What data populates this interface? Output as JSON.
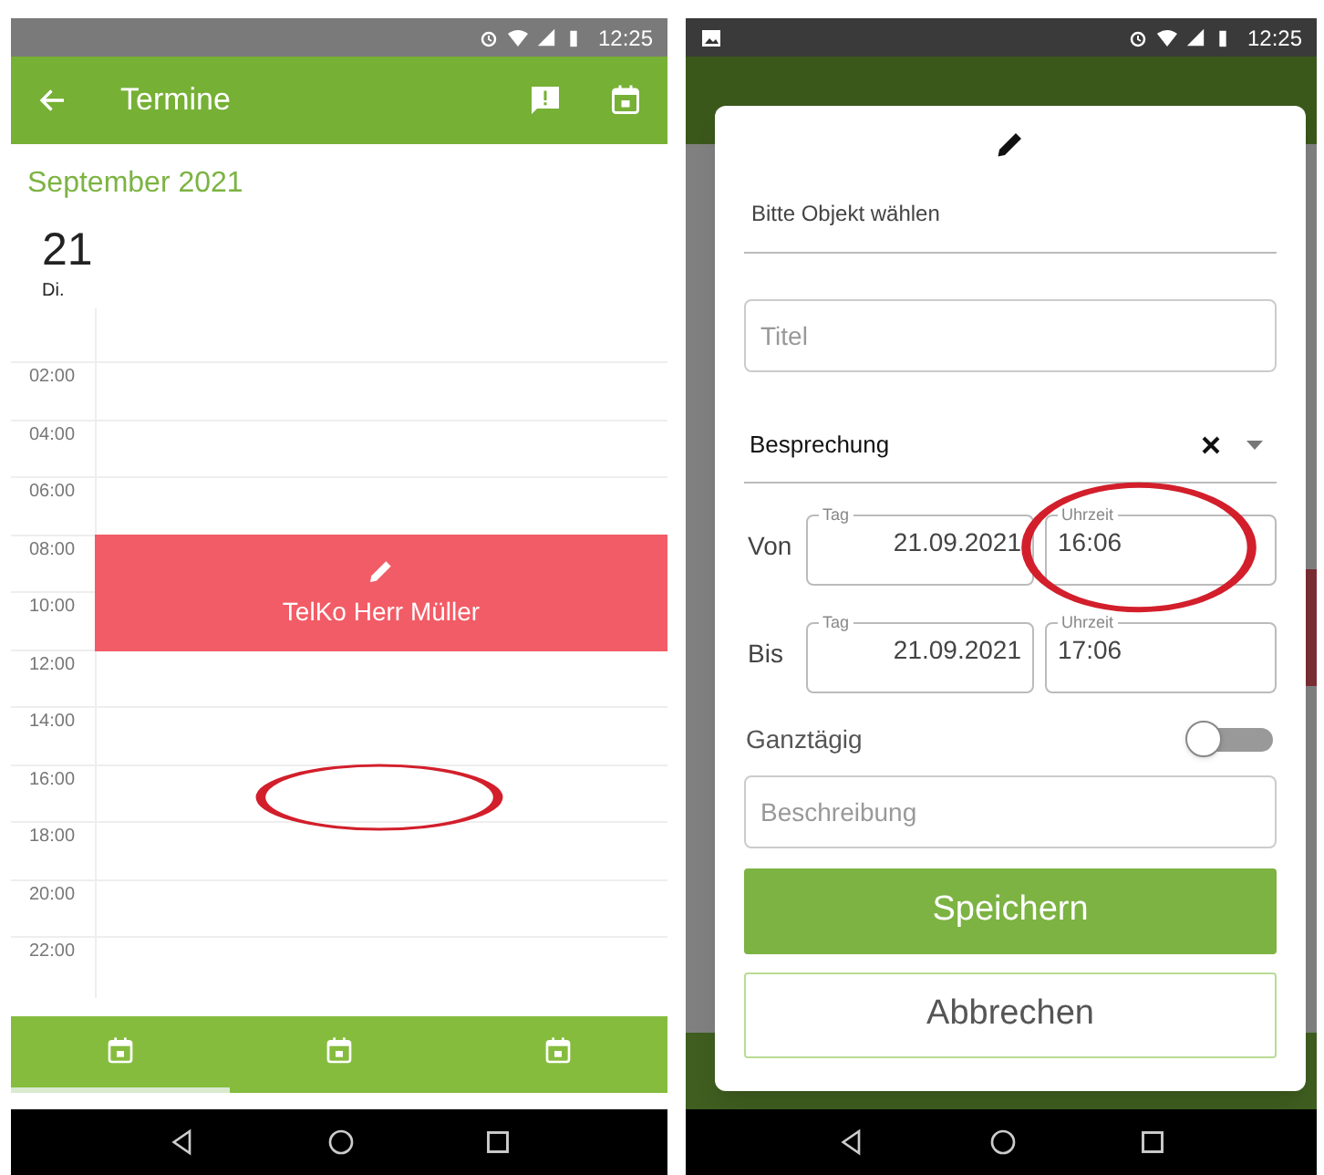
{
  "calendar_screen": {
    "status_bar": {
      "time": "12:25"
    },
    "app_bar": {
      "title": "Termine"
    },
    "month": "September 2021",
    "day": {
      "number": "21",
      "weekday": "Di."
    },
    "hours": [
      "02:00",
      "04:00",
      "06:00",
      "08:00",
      "10:00",
      "12:00",
      "14:00",
      "16:00",
      "18:00",
      "20:00",
      "22:00"
    ],
    "events": [
      {
        "title": "TelKo Herr Müller",
        "color": "#f25c66"
      }
    ],
    "bottom_tabs": [
      {
        "selected": true
      },
      {
        "selected": false
      },
      {
        "selected": false
      }
    ],
    "annotations": [
      {
        "kind": "ellipse"
      }
    ]
  },
  "dialog_screen": {
    "status_bar": {
      "time": "12:25"
    },
    "object_select": {
      "placeholder": "Bitte Objekt wählen"
    },
    "title_field": {
      "placeholder": "Titel"
    },
    "type_select": {
      "value": "Besprechung"
    },
    "ranges": [
      {
        "label": "Von",
        "date_label": "Tag",
        "date": "21.09.2021",
        "time_label": "Uhrzeit",
        "time": "16:06"
      },
      {
        "label": "Bis",
        "date_label": "Tag",
        "date": "21.09.2021",
        "time_label": "Uhrzeit",
        "time": "17:06"
      }
    ],
    "all_day": {
      "label": "Ganztägig",
      "on": false
    },
    "description_field": {
      "placeholder": "Beschreibung"
    },
    "buttons": [
      {
        "label": "Speichern",
        "kind": "primary"
      },
      {
        "label": "Abbrechen",
        "kind": "secondary"
      }
    ],
    "annotations": [
      {
        "kind": "ellipse"
      }
    ]
  }
}
